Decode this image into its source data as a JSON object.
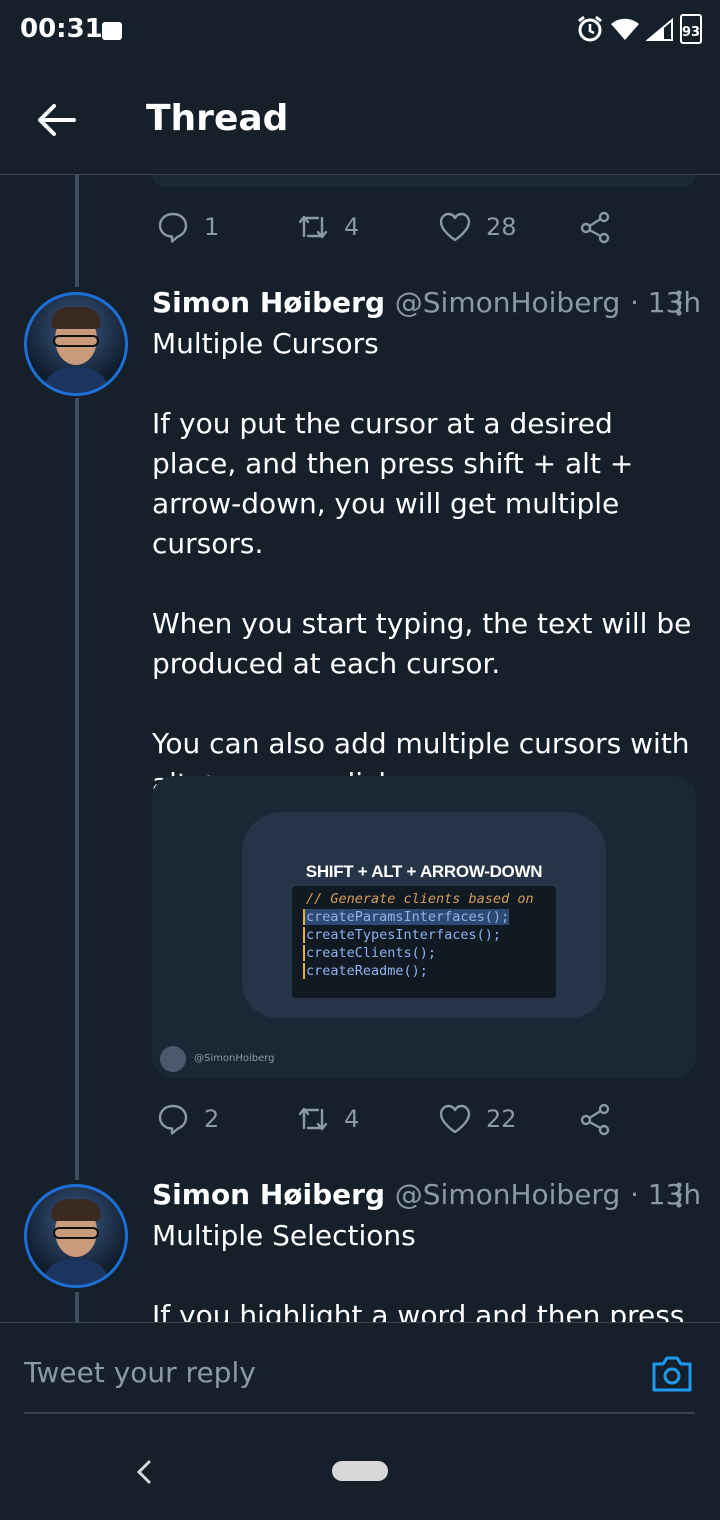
{
  "status_bar": {
    "time": "00:31",
    "battery": "93"
  },
  "header": {
    "title": "Thread"
  },
  "prev_tweet_actions": {
    "replies": "1",
    "retweets": "4",
    "likes": "28"
  },
  "tweets": [
    {
      "name": "Simon Høiberg",
      "handle": "@SimonHoiberg",
      "time": "· 13h",
      "paragraphs": [
        "Multiple Cursors",
        "If you put the cursor at a desired place, and then press shift + alt + arrow-down, you will get multiple cursors.",
        "When you start typing, the text will be produced at each cursor.",
        "You can also add multiple cursors with alt + mouse click."
      ],
      "media": {
        "title": "SHIFT + ALT + ARROW-DOWN",
        "code": [
          "// Generate clients based on",
          "createParamsInterfaces();",
          "createTypesInterfaces();",
          "createClients();",
          "createReadme();"
        ],
        "credit": "@SimonHoiberg"
      },
      "actions": {
        "replies": "2",
        "retweets": "4",
        "likes": "22"
      }
    },
    {
      "name": "Simon Høiberg",
      "handle": "@SimonHoiberg",
      "time": "· 13h",
      "paragraphs": [
        "Multiple Selections",
        "If you highlight a word and then press"
      ]
    }
  ],
  "reply": {
    "placeholder": "Tweet your reply"
  },
  "colors": {
    "background": "#15202b",
    "muted": "#8b98a5",
    "accent": "#1d9bf0"
  },
  "icons": [
    "back-arrow-icon",
    "reply-icon",
    "retweet-icon",
    "like-icon",
    "share-icon",
    "more-icon",
    "camera-icon",
    "alarm-icon",
    "wifi-icon",
    "signal-icon",
    "battery-icon",
    "image-icon"
  ]
}
